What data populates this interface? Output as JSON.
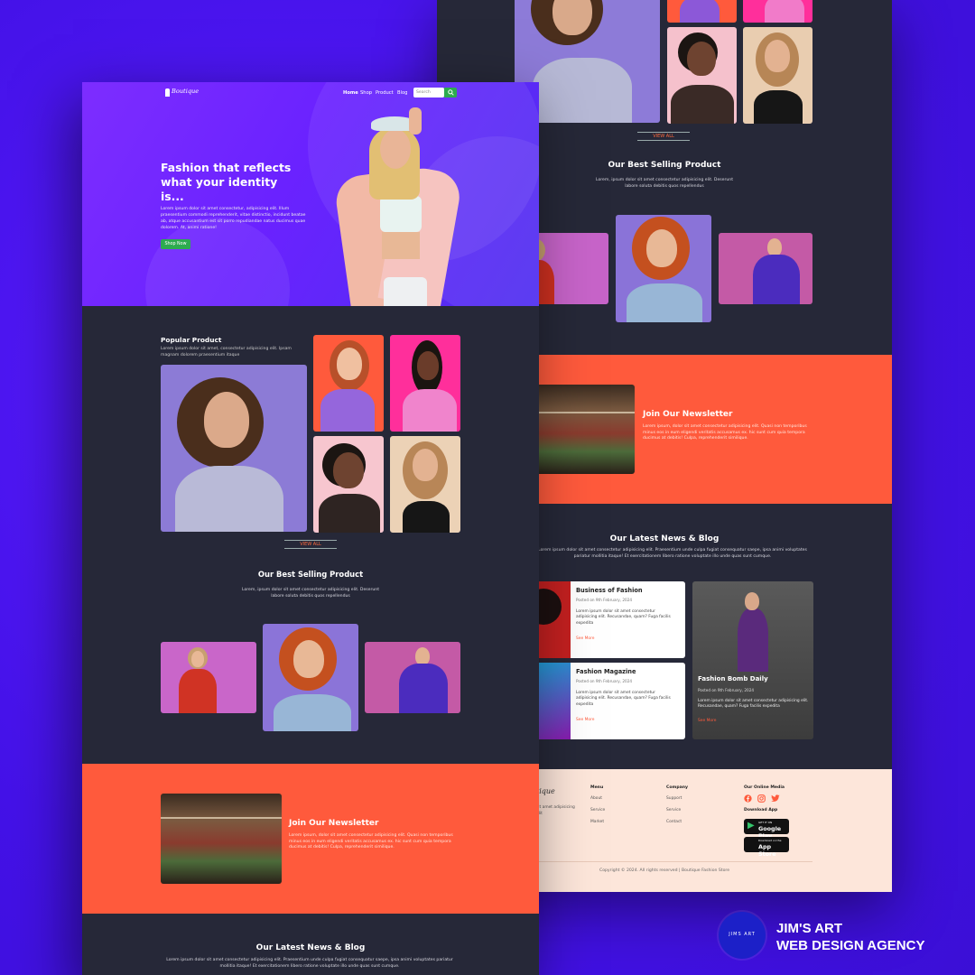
{
  "brand": {
    "logo": "Boutique"
  },
  "nav": [
    "Home",
    "Shop",
    "Product",
    "Blog"
  ],
  "search": {
    "placeholder": "Search"
  },
  "hero": {
    "title": "Fashion that reflects what your identity is...",
    "text": "Lorem ipsum dolor sit amet consectetur, adipisicing elit. Illum praesentium commodi reprehenderit, vitae distinctio, incidunt beatae ab, atque accusantium est sit porro repudiandae natus ducimus quae dolorem. At, animi ratione!",
    "button": "Shop Now"
  },
  "popular": {
    "title": "Popular Product",
    "text": "Lorem ipsum dolor sit amet, consectetur adipisicing elit. Ipsam magnam dolorem praesentium itaque"
  },
  "view_all": "VIEW ALL",
  "best_selling": {
    "title": "Our Best Selling Product",
    "text": "Lorem, ipsum dolor sit amet consectetur adipisicing elit. Deserunt labore soluta debitis quos repellendus"
  },
  "newsletter": {
    "title": "Join Our Newsletter",
    "text": "Lorem ipsum, dolor sit amet consectetur adipisicing elit. Quasi non temporibus minus eos in eum eligendi veritatis accusamus ex. hic sunt cum quia tempora ducimus at debitis! Culpa, reprehenderit similique."
  },
  "blog": {
    "title": "Our Latest News & Blog",
    "text": "Lorem ipsum dolor sit amet consectetur adipisicing elit. Praesentium unde culpa fugiat consequatur saepe, ipsa animi voluptates pariatur mollitia itaque! Et exercitationem libero ratione voluptate illo unde quas sunt cumque.",
    "posts": [
      {
        "title": "Business of Fashion",
        "date": "Posted on 9th February, 2024",
        "text": "Lorem ipsum dolor sit amet consectetur adipisicing elit. Recusandae, quam? Fuga facilis expedita",
        "more": "See More"
      },
      {
        "title": "Fashion Magazine",
        "date": "Posted on 9th February, 2024",
        "text": "Lorem ipsum dolor sit amet consectetur adipisicing elit. Recusandae, quam? Fuga facilis expedita",
        "more": "See More"
      },
      {
        "title": "Fashion Bomb Daily",
        "date": "Posted on 9th February, 2024",
        "text": "Lorem ipsum dolor sit amet consectetur adipisicing elit. Recusandae, quam? Fuga facilis expedita",
        "more": "See More"
      }
    ]
  },
  "footer": {
    "logo": "tique",
    "about": "sit amet adipisicing elit",
    "menu_head": "Menu",
    "menu": [
      "About",
      "Service",
      "Market"
    ],
    "company_head": "Company",
    "company": [
      "Support",
      "Service",
      "Contact"
    ],
    "media_head": "Our Online Media",
    "download_head": "Download App",
    "google_small": "GET IT ON",
    "google": "Google Play",
    "apple_small": "Download on the",
    "apple": "App Store",
    "copyright": "Copyright © 2024. All rights reserved | Boutique Fashion Store"
  },
  "agency": {
    "badge": "JIMS ART",
    "line1": "JIM'S ART",
    "line2": "WEB DESIGN AGENCY"
  },
  "colors": {
    "background": "#4a14ee",
    "dark": "#262838",
    "accent": "#ff5a3c",
    "green": "#2dab4f",
    "footer": "#fde6da"
  },
  "icons": [
    "search-icon",
    "facebook-icon",
    "instagram-icon",
    "twitter-icon",
    "google-play-icon",
    "apple-icon"
  ]
}
